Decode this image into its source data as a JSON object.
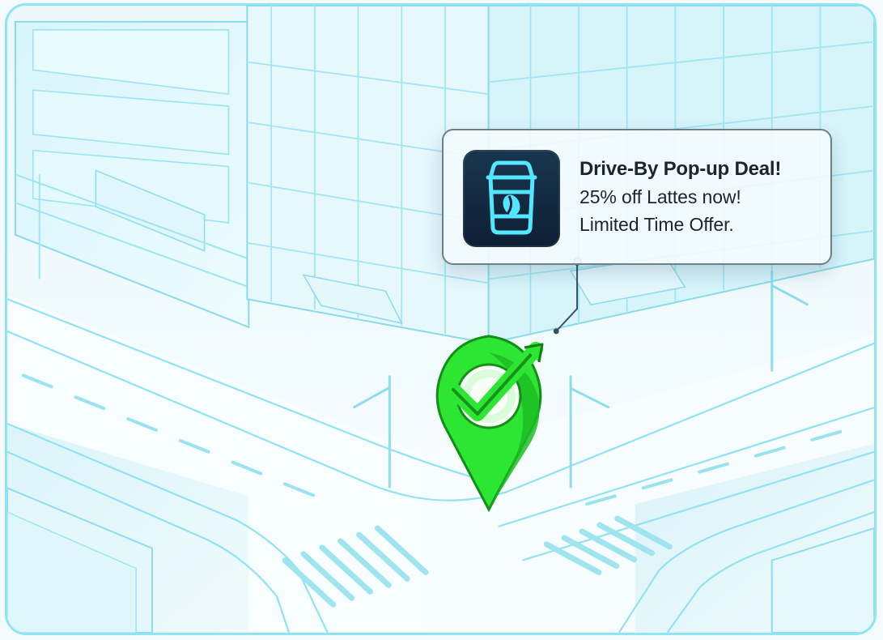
{
  "notification": {
    "title": "Drive-By Pop-up Deal!",
    "line1": "25% off Lattes now!",
    "line2": "Limited Time Offer.",
    "icon": "coffee-cup-icon"
  },
  "map": {
    "pin_icon": "location-pin-check-icon",
    "accent": "#2de533",
    "road_color": "#8fe3f2"
  }
}
